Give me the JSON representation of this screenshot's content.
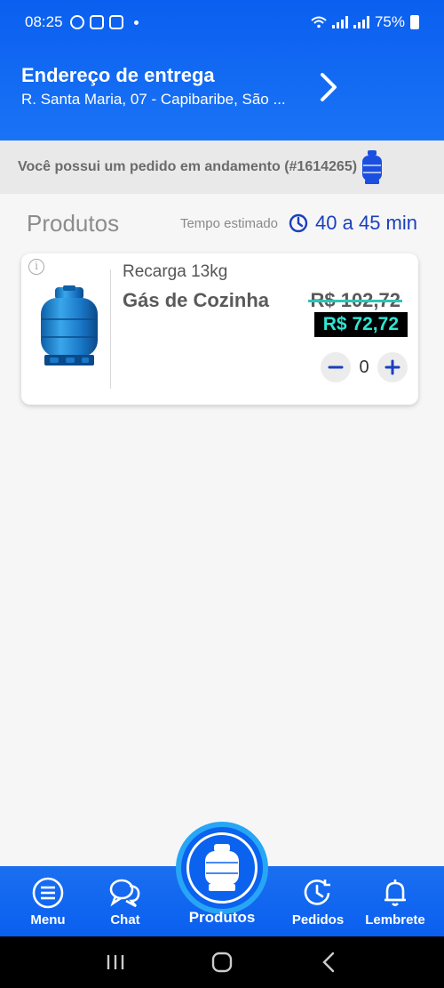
{
  "status_bar": {
    "time": "08:25",
    "battery": "75%"
  },
  "header": {
    "title": "Endereço de entrega",
    "address": "R. Santa Maria, 07 - Capibaribe, São ..."
  },
  "order_banner": {
    "text": "Você possui um pedido em andamento (#1614265)"
  },
  "products": {
    "title": "Produtos",
    "eta_label": "Tempo estimado",
    "eta_value": "40 a 45 min"
  },
  "product_card": {
    "subtitle": "Recarga 13kg",
    "name": "Gás de Cozinha",
    "old_price": "R$ 102,72",
    "new_price": "R$ 72,72",
    "quantity": "0",
    "info_icon": "i"
  },
  "bottom_nav": {
    "items": [
      {
        "label": "Menu",
        "icon": "menu-icon"
      },
      {
        "label": "Chat",
        "icon": "chat-icon"
      },
      {
        "label": "Produtos",
        "icon": "gas-cylinder-icon"
      },
      {
        "label": "Pedidos",
        "icon": "history-icon"
      },
      {
        "label": "Lembrete",
        "icon": "bell-icon"
      }
    ]
  },
  "colors": {
    "primary": "#0a5ff0",
    "accent_text": "#1a3fc0",
    "price_new_bg": "#000000",
    "price_new_text": "#2ee6d6",
    "strike": "#2ec4b6"
  }
}
